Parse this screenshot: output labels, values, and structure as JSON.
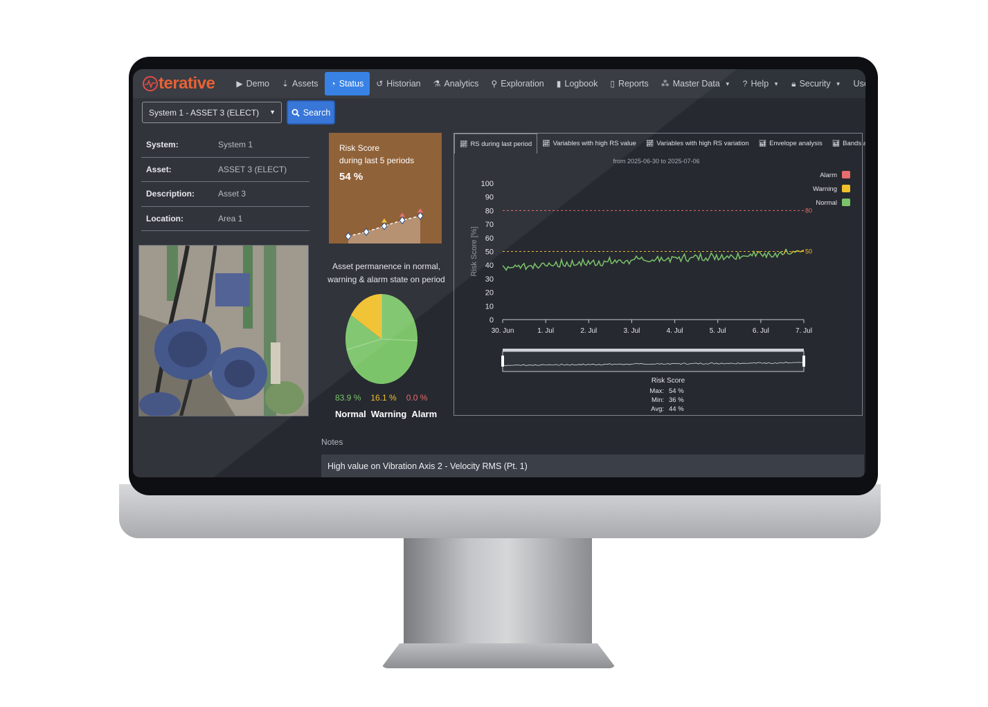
{
  "navbar": {
    "brand": "terative",
    "items": [
      {
        "label": "Demo",
        "icon": "play-circle-icon",
        "active": false,
        "dropdown": false
      },
      {
        "label": "Assets",
        "icon": "sort-icon",
        "active": false,
        "dropdown": false
      },
      {
        "label": "Status",
        "icon": "dashboard-icon",
        "active": true,
        "dropdown": false
      },
      {
        "label": "Historian",
        "icon": "history-icon",
        "active": false,
        "dropdown": false
      },
      {
        "label": "Analytics",
        "icon": "flask-icon",
        "active": false,
        "dropdown": false
      },
      {
        "label": "Exploration",
        "icon": "search-icon",
        "active": false,
        "dropdown": false
      },
      {
        "label": "Logbook",
        "icon": "book-icon",
        "active": false,
        "dropdown": false
      },
      {
        "label": "Reports",
        "icon": "file-icon",
        "active": false,
        "dropdown": false
      },
      {
        "label": "Master Data",
        "icon": "cubes-icon",
        "active": false,
        "dropdown": true
      },
      {
        "label": "Help",
        "icon": "question-circle-icon",
        "active": false,
        "dropdown": true
      },
      {
        "label": "Security",
        "icon": "lock-icon",
        "active": false,
        "dropdown": true
      }
    ],
    "user": "User: \"asua"
  },
  "asset_select": {
    "value": "System 1 - ASSET 3 (ELECT)"
  },
  "search_button": {
    "label": "Search"
  },
  "info": [
    {
      "label": "System:",
      "value": "System 1"
    },
    {
      "label": "Asset:",
      "value": "ASSET 3 (ELECT)"
    },
    {
      "label": "Description:",
      "value": "Asset 3"
    },
    {
      "label": "Location:",
      "value": "Area 1"
    }
  ],
  "risk_card": {
    "title_line1": "Risk Score",
    "title_line2": "during last 5 periods",
    "value": "54 %",
    "trend": [
      30,
      36,
      44,
      52,
      58
    ]
  },
  "permanence": {
    "title_line1": "Asset permanence in normal,",
    "title_line2": "warning & alarm state on period",
    "values": [
      {
        "value": "83.9 %",
        "label": "Normal",
        "fraction": 0.839,
        "color": "#7cc46a"
      },
      {
        "value": "16.1 %",
        "label": "Warning",
        "fraction": 0.161,
        "color": "#f0c02c"
      },
      {
        "value": "0.0 %",
        "label": "Alarm",
        "fraction": 0.0,
        "color": "#e86c6c"
      }
    ]
  },
  "tabs": [
    {
      "label": "RS during last period",
      "active": true
    },
    {
      "label": "Variables with high RS value",
      "active": false
    },
    {
      "label": "Variables with high RS variation",
      "active": false
    },
    {
      "label": "Envelope analysis",
      "active": false
    },
    {
      "label": "Bands analysis",
      "active": false
    }
  ],
  "chart_data": {
    "type": "line",
    "subtitle": "from 2025-06-30 to 2025-07-06",
    "ylabel": "Risk Score [%]",
    "ylim": [
      0,
      100
    ],
    "yticks": [
      0,
      10,
      20,
      30,
      40,
      50,
      60,
      70,
      80,
      90,
      100
    ],
    "xticks": [
      "30. Jun",
      "1. Jul",
      "2. Jul",
      "3. Jul",
      "4. Jul",
      "5. Jul",
      "6. Jul",
      "7. Jul"
    ],
    "xrange_days": [
      0,
      7
    ],
    "thresholds": [
      {
        "name": "Alarm",
        "value": 80,
        "label": "80",
        "color": "#e86c6c"
      },
      {
        "name": "Warning",
        "value": 50,
        "label": "50",
        "color": "#f0c02c"
      }
    ],
    "legend": [
      {
        "name": "Alarm",
        "color": "#e86c6c"
      },
      {
        "name": "Warning",
        "color": "#f0c02c"
      },
      {
        "name": "Normal",
        "color": "#7cc46a"
      }
    ],
    "legend_position": "top-right",
    "series": [
      {
        "name": "Risk Score",
        "trend_start": 38.5,
        "trend_end": 49.5,
        "noise": 2.2,
        "points": 170
      }
    ],
    "navigator_label": "Risk Score",
    "stats": [
      {
        "label": "Max:",
        "value": "54 %"
      },
      {
        "label": "Min:",
        "value": "36 %"
      },
      {
        "label": "Avg:",
        "value": "44 %"
      }
    ]
  },
  "notes": {
    "label": "Notes",
    "text": "High value on Vibration Axis 2 - Velocity RMS (Pt. 1)"
  }
}
